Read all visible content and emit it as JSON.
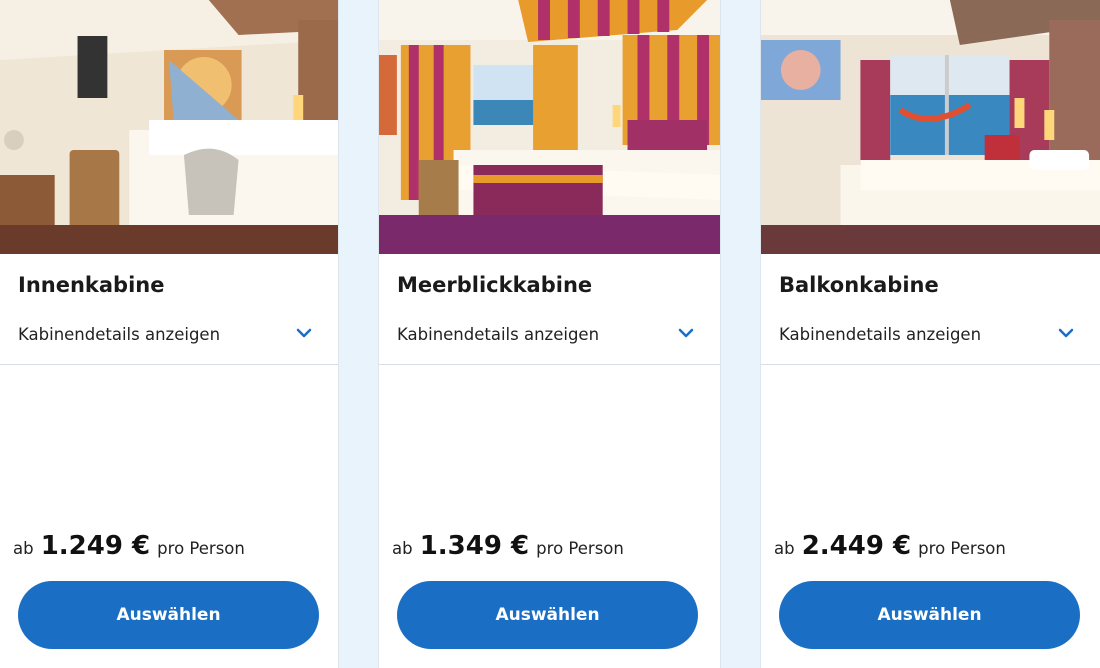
{
  "theme": {
    "accent": "#1a6fc4",
    "background": "#e9f3fb",
    "chevron": "#1a6fc4"
  },
  "cabins": [
    {
      "title": "Innenkabine",
      "details_label": "Kabinendetails anzeigen",
      "price_prefix": "ab",
      "price": "1.249 €",
      "price_suffix": "pro Person",
      "button_label": "Auswählen",
      "photo": "inside-cabin-photo"
    },
    {
      "title": "Meerblickkabine",
      "details_label": "Kabinendetails anzeigen",
      "price_prefix": "ab",
      "price": "1.349 €",
      "price_suffix": "pro Person",
      "button_label": "Auswählen",
      "photo": "ocean-view-cabin-photo"
    },
    {
      "title": "Balkonkabine",
      "details_label": "Kabinendetails anzeigen",
      "price_prefix": "ab",
      "price": "2.449 €",
      "price_suffix": "pro Person",
      "button_label": "Auswählen",
      "photo": "balcony-cabin-photo"
    }
  ]
}
